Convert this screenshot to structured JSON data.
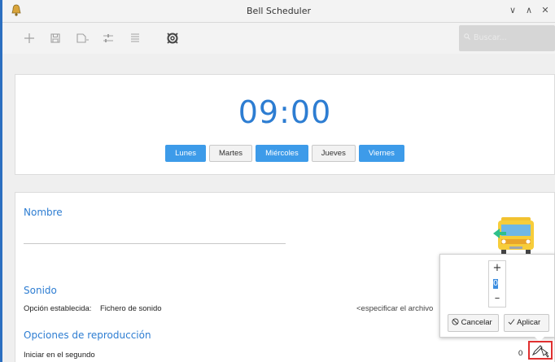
{
  "window": {
    "title": "Bell Scheduler",
    "controls": [
      "∨",
      "∧",
      "✕"
    ]
  },
  "toolbar": {
    "icons": [
      "add-icon",
      "save-icon",
      "add-document-icon",
      "sliders-icon",
      "list-icon",
      "lifebuoy-icon"
    ],
    "search_placeholder": "Buscar..."
  },
  "clock": {
    "time": "09:00"
  },
  "days": [
    {
      "label": "Lunes",
      "active": true
    },
    {
      "label": "Martes",
      "active": false
    },
    {
      "label": "Miércoles",
      "active": true
    },
    {
      "label": "Jueves",
      "active": false
    },
    {
      "label": "Viernes",
      "active": true
    }
  ],
  "form": {
    "name_title": "Nombre",
    "name_value": "",
    "sound_title": "Sonido",
    "sound_option_label": "Opción establecida:",
    "sound_option_value": "Fichero de sonido",
    "sound_file_placeholder": "<especificar el archivo",
    "playback_title": "Opciones de reproducción",
    "start_second_label": "Iniciar en el segundo",
    "start_second_value": "0"
  },
  "popover": {
    "plus": "+",
    "value": "0",
    "minus": "–",
    "cancel_label": "Cancelar",
    "apply_label": "Aplicar"
  },
  "colors": {
    "accent": "#2d7dd2",
    "day_active": "#3d9be9",
    "highlight": "#e03030"
  }
}
